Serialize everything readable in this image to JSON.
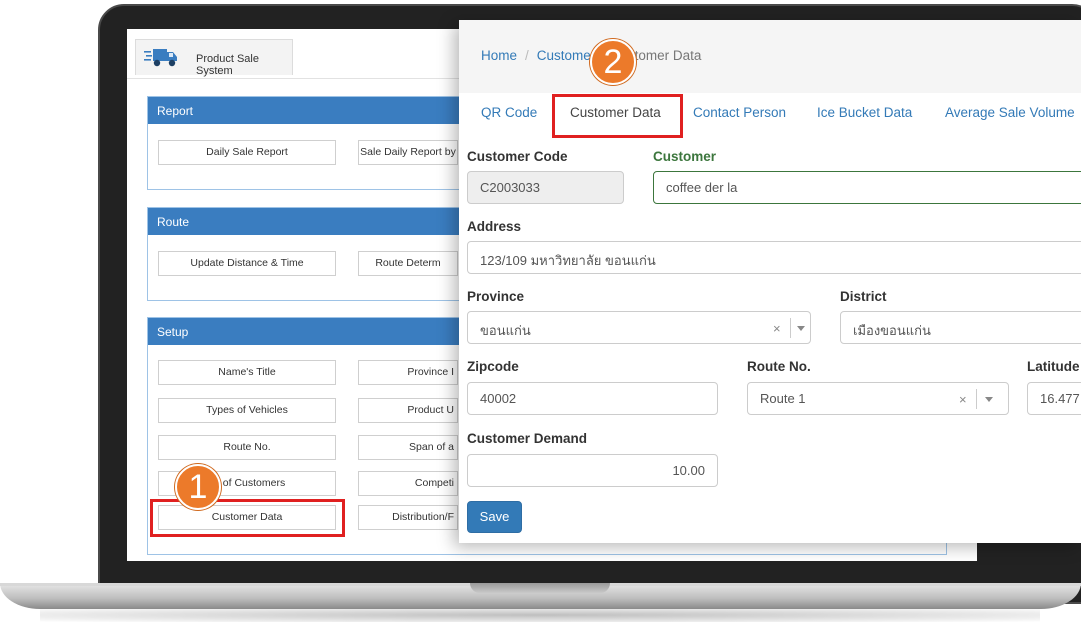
{
  "app": {
    "title": "Product Sale System"
  },
  "report": {
    "title": "Report",
    "buttons": [
      "Daily Sale Report",
      "Sale Daily Report by"
    ]
  },
  "route": {
    "title": "Route",
    "buttons": [
      "Update Distance & Time",
      "Route Determ"
    ]
  },
  "setup": {
    "title": "Setup",
    "left_buttons": [
      "Name's Title",
      "Types of Vehicles",
      "Route No.",
      "Types of Customers",
      "Customer Data"
    ],
    "left_labels": [
      "Name's Title",
      "Types of Vehicles",
      "Route No.",
      "es of Customers",
      "Customer Data"
    ],
    "right_buttons": [
      "Province I",
      "Product U",
      "Span of a",
      "Competi",
      "Distribution/F"
    ]
  },
  "breadcrumb": {
    "home": "Home",
    "middle": "Custome",
    "current": "Customer Data"
  },
  "tabs": [
    "QR Code",
    "Customer Data",
    "Contact Person",
    "Ice Bucket Data",
    "Average Sale Volume"
  ],
  "form": {
    "customer_code": {
      "label": "Customer Code",
      "value": "C2003033"
    },
    "customer": {
      "label": "Customer",
      "value": "coffee der la"
    },
    "address": {
      "label": "Address",
      "value": "123/109 มหาวิทยาลัย ขอนแก่น"
    },
    "province": {
      "label": "Province",
      "value": "ขอนแก่น"
    },
    "district": {
      "label": "District",
      "value": "เมืองขอนแก่น"
    },
    "zipcode": {
      "label": "Zipcode",
      "value": "40002"
    },
    "route_no": {
      "label": "Route No.",
      "value": "Route 1"
    },
    "latitude": {
      "label": "Latitude",
      "value": "16.477"
    },
    "customer_demand": {
      "label": "Customer Demand",
      "value": "10.00"
    },
    "save_label": "Save"
  },
  "markers": {
    "step1": "1",
    "step2": "2"
  },
  "colors": {
    "primary": "#337ab7",
    "panel_header": "#3a7dc0",
    "highlight": "#e02020",
    "marker": "#ec7a2a",
    "valid": "#3c763d"
  }
}
